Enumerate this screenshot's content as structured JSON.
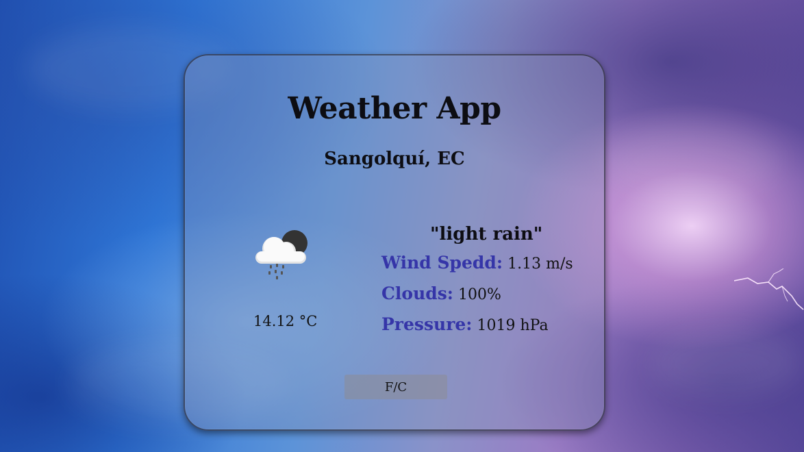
{
  "app": {
    "title": "Weather App"
  },
  "location": "Sangolquí, EC",
  "current": {
    "icon": "cloud-rain-moon-icon",
    "temperature": "14.12 °C",
    "description": "\"light rain\""
  },
  "stats": {
    "wind_label": "Wind Spedd:",
    "wind_value": "1.13 m/s",
    "clouds_label": "Clouds:",
    "clouds_value": "100%",
    "pressure_label": "Pressure:",
    "pressure_value": "1019 hPa"
  },
  "controls": {
    "unit_toggle_label": "F/C"
  },
  "colors": {
    "stat_label": "#3535a8",
    "text": "#0d0d12"
  }
}
